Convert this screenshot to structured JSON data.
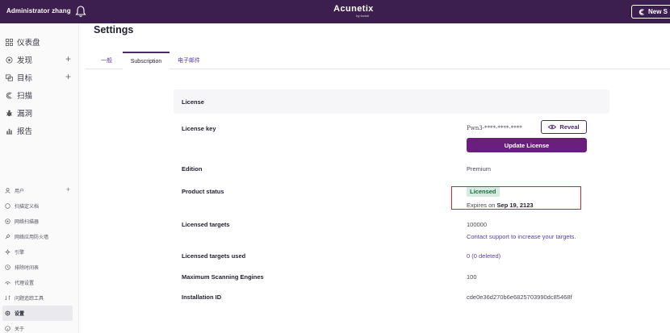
{
  "topbar": {
    "user": "Administrator zhang",
    "logo_name": "Acunetix",
    "logo_sub": "by Invicti",
    "new_scan_label": "New S"
  },
  "sidebar": {
    "main": [
      {
        "label": "仪表盘",
        "icon": "dashboard-icon"
      },
      {
        "label": "发现",
        "icon": "discovery-icon",
        "has_add": true
      },
      {
        "label": "目标",
        "icon": "targets-icon",
        "has_add": true
      },
      {
        "label": "扫描",
        "icon": "scans-icon"
      },
      {
        "label": "漏洞",
        "icon": "vulnerabilities-icon"
      },
      {
        "label": "报告",
        "icon": "reports-icon"
      }
    ],
    "sub": [
      {
        "label": "用户",
        "icon": "users-icon",
        "has_add": true
      },
      {
        "label": "扫描定义档",
        "icon": "scan-profiles-icon"
      },
      {
        "label": "网络扫描器",
        "icon": "network-scanner-icon"
      },
      {
        "label": "网络应用防火墙",
        "icon": "waf-icon"
      },
      {
        "label": "引擎",
        "icon": "engines-icon"
      },
      {
        "label": "排除时间表",
        "icon": "excluded-hours-icon"
      },
      {
        "label": "代理设置",
        "icon": "proxy-icon"
      },
      {
        "label": "问题追踪工具",
        "icon": "issue-tracker-icon"
      },
      {
        "label": "设置",
        "icon": "settings-icon",
        "active": true
      },
      {
        "label": "关于",
        "icon": "about-icon"
      }
    ]
  },
  "page": {
    "title": "Settings",
    "tabs": {
      "general": "一般",
      "subscription": "Subscription",
      "email": "电子邮件"
    }
  },
  "license": {
    "header": "License",
    "key_label": "License key",
    "key_value": "Pwn3-****-****-****",
    "reveal_label": "Reveal",
    "update_label": "Update License",
    "edition_label": "Edition",
    "edition_value": "Premium",
    "status_label": "Product status",
    "status_badge": "Licensed",
    "expires_prefix": "Expires on",
    "expires_date": "Sep 19, 2123",
    "targets_label": "Licensed targets",
    "targets_value": "100000",
    "targets_contact": "Contact support to increase your targets.",
    "targets_used_label": "Licensed targets used",
    "targets_used_value": "0 (0 deleted)",
    "engines_label": "Maximum Scanning Engines",
    "engines_value": "100",
    "install_label": "Installation ID",
    "install_value": "cde0e36d270b6e6825703990dc85468f"
  },
  "colors": {
    "topbar": "#3d1f4f",
    "accent": "#6a1f7f",
    "link": "#5b3fa0",
    "licensed_bg": "#d7ece0",
    "licensed_fg": "#1c6b41",
    "highlight": "#e02020"
  }
}
